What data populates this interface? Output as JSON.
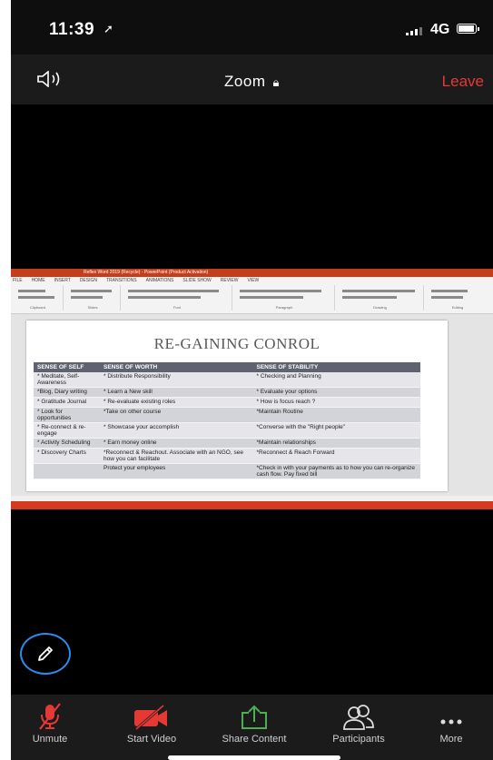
{
  "status_bar": {
    "time": "11:39",
    "network": "4G"
  },
  "header": {
    "title": "Zoom",
    "leave_label": "Leave"
  },
  "ppt": {
    "window_title": "Reflex Word 2019 (Recycle) - PowerPoint (Product Activation)",
    "ribbon_tabs": [
      "FILE",
      "HOME",
      "INSERT",
      "DESIGN",
      "TRANSITIONS",
      "ANIMATIONS",
      "SLIDE SHOW",
      "REVIEW",
      "VIEW"
    ],
    "ribbon_groups": [
      "Clipboard",
      "Slides",
      "Font",
      "Paragraph",
      "Drawing",
      "Editing"
    ]
  },
  "slide": {
    "title": "RE-GAINING CONROL",
    "columns": [
      "SENSE OF SELF",
      "SENSE OF WORTH",
      "SENSE OF STABILITY"
    ],
    "rows": [
      [
        "* Meditate, Self-Awareness",
        "* Distribute Responsibility",
        "* Checking and Planning"
      ],
      [
        "*Blog, Diary writing",
        "* Learn a New skill",
        "* Evaluate your options"
      ],
      [
        "* Gratitude Journal",
        "* Re-evaluate existing roles",
        "* How is focus reach ?"
      ],
      [
        "* Look for opportunities",
        "*Take on other course",
        "*Maintain Routine"
      ],
      [
        "* Re-connect & re-engage",
        "* Showcase your accomplish",
        "*Converse with the \"Right people\""
      ],
      [
        "* Activity Scheduling",
        "* Earn money online",
        "*Maintain relationships"
      ],
      [
        "* Discovery Charts",
        "*Reconnect & Reachout. Associate with an NGO, see how you can facilitate",
        "*Reconnect & Reach Forward"
      ],
      [
        "",
        "Protect your employees",
        "*Check in with your payments as to how you can re-organize cash flow. Pay fixed bill"
      ]
    ]
  },
  "toolbar": {
    "unmute": "Unmute",
    "start_video": "Start Video",
    "share_content": "Share Content",
    "participants": "Participants",
    "more": "More"
  },
  "colors": {
    "leave": "#e53935",
    "muted": "#e53935",
    "share": "#4caf50",
    "annotate_ring": "#2d8ceb"
  }
}
